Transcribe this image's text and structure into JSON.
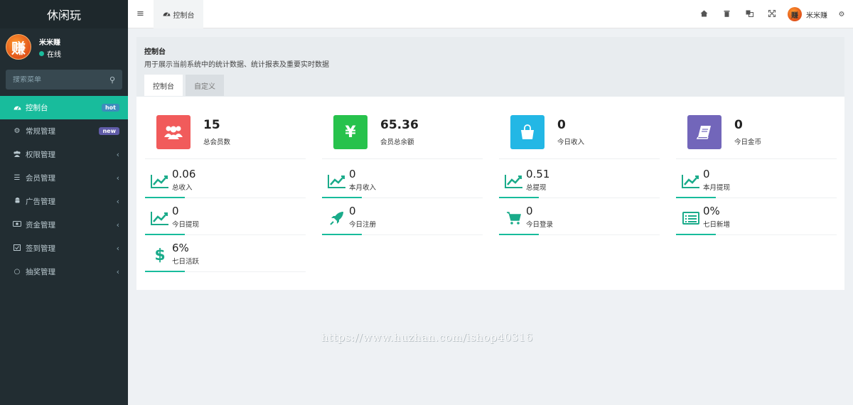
{
  "app": {
    "title": "休闲玩"
  },
  "user": {
    "name": "米米赚",
    "status": "在线",
    "avatar_char": "赚"
  },
  "search": {
    "placeholder": "搜索菜单"
  },
  "sidebar": {
    "items": [
      {
        "label": "控制台",
        "icon": "dashboard-icon",
        "badge": "hot"
      },
      {
        "label": "常规管理",
        "icon": "cogs-icon",
        "badge": "new"
      },
      {
        "label": "权限管理",
        "icon": "group-icon"
      },
      {
        "label": "会员管理",
        "icon": "list-icon"
      },
      {
        "label": "广告管理",
        "icon": "android-icon"
      },
      {
        "label": "资金管理",
        "icon": "money-icon"
      },
      {
        "label": "签到管理",
        "icon": "calendar-check-icon"
      },
      {
        "label": "抽奖管理",
        "icon": "circle-icon"
      }
    ]
  },
  "topbar": {
    "tab_label": "控制台",
    "user_name": "米米赚"
  },
  "page": {
    "title": "控制台",
    "description": "用于展示当前系统中的统计数据、统计报表及重要实时数据",
    "tabs": [
      "控制台",
      "自定义"
    ]
  },
  "cards": [
    {
      "value": "15",
      "label": "总会员数",
      "icon": "users-icon",
      "color": "#f15b5b"
    },
    {
      "value": "65.36",
      "label": "会员总余额",
      "icon": "yen-icon",
      "color": "#27c24c"
    },
    {
      "value": "0",
      "label": "今日收入",
      "icon": "shopping-bag-icon",
      "color": "#23b7e5"
    },
    {
      "value": "0",
      "label": "今日金币",
      "icon": "book-icon",
      "color": "#7266ba"
    }
  ],
  "stats": [
    {
      "value": "0.06",
      "label": "总收入",
      "icon": "area-chart-icon"
    },
    {
      "value": "0",
      "label": "本月收入",
      "icon": "area-chart-icon"
    },
    {
      "value": "0.51",
      "label": "总提现",
      "icon": "area-chart-icon"
    },
    {
      "value": "0",
      "label": "本月提现",
      "icon": "area-chart-icon"
    },
    {
      "value": "0",
      "label": "今日提现",
      "icon": "area-chart-icon"
    },
    {
      "value": "0",
      "label": "今日注册",
      "icon": "rocket-icon"
    },
    {
      "value": "0",
      "label": "今日登录",
      "icon": "cart-icon"
    },
    {
      "value": "0%",
      "label": "七日新增",
      "icon": "list-alt-icon"
    },
    {
      "value": "6%",
      "label": "七日活跃",
      "icon": "dollar-icon"
    }
  ],
  "watermark": "https://www.huzhan.com/ishop40316"
}
